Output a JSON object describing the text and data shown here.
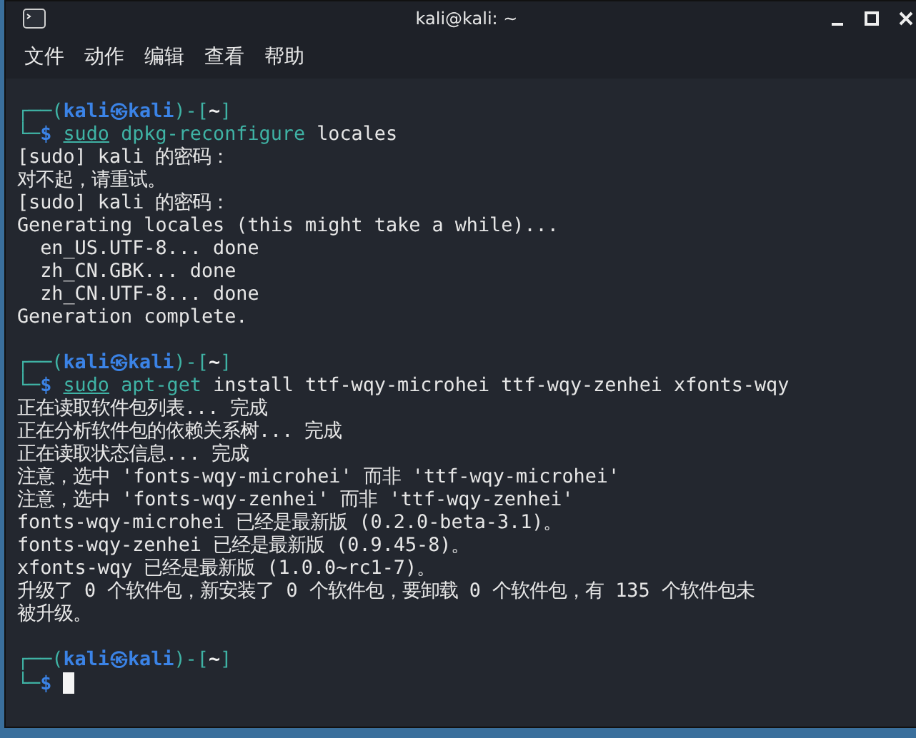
{
  "window": {
    "title": "kali@kali: ~"
  },
  "menu": [
    "文件",
    "动作",
    "编辑",
    "查看",
    "帮助"
  ],
  "terminal": [
    {
      "kind": "prompt",
      "open": "┌──(",
      "user": "kali",
      "at": "㉿",
      "host": "kali",
      "mid": ")-[",
      "dir": "~",
      "close": "]"
    },
    {
      "kind": "command",
      "corner": "└─",
      "sigil": "$",
      "sudo": "sudo",
      "program": "dpkg-reconfigure",
      "args": "locales"
    },
    {
      "kind": "output",
      "text": "[sudo] kali 的密码："
    },
    {
      "kind": "output",
      "text": "对不起，请重试。"
    },
    {
      "kind": "output",
      "text": "[sudo] kali 的密码："
    },
    {
      "kind": "output",
      "text": "Generating locales (this might take a while)..."
    },
    {
      "kind": "output",
      "text": "  en_US.UTF-8... done"
    },
    {
      "kind": "output",
      "text": "  zh_CN.GBK... done"
    },
    {
      "kind": "output",
      "text": "  zh_CN.UTF-8... done"
    },
    {
      "kind": "output",
      "text": "Generation complete."
    },
    {
      "kind": "blank"
    },
    {
      "kind": "prompt",
      "open": "┌──(",
      "user": "kali",
      "at": "㉿",
      "host": "kali",
      "mid": ")-[",
      "dir": "~",
      "close": "]"
    },
    {
      "kind": "command",
      "corner": "└─",
      "sigil": "$",
      "sudo": "sudo",
      "program": "apt-get",
      "args": "install ttf-wqy-microhei ttf-wqy-zenhei xfonts-wqy"
    },
    {
      "kind": "output",
      "text": "正在读取软件包列表... 完成"
    },
    {
      "kind": "output",
      "text": "正在分析软件包的依赖关系树... 完成"
    },
    {
      "kind": "output",
      "text": "正在读取状态信息... 完成"
    },
    {
      "kind": "output",
      "text": "注意，选中 'fonts-wqy-microhei' 而非 'ttf-wqy-microhei'"
    },
    {
      "kind": "output",
      "text": "注意，选中 'fonts-wqy-zenhei' 而非 'ttf-wqy-zenhei'"
    },
    {
      "kind": "output",
      "text": "fonts-wqy-microhei 已经是最新版 (0.2.0-beta-3.1)。"
    },
    {
      "kind": "output",
      "text": "fonts-wqy-zenhei 已经是最新版 (0.9.45-8)。"
    },
    {
      "kind": "output",
      "text": "xfonts-wqy 已经是最新版 (1.0.0~rc1-7)。"
    },
    {
      "kind": "output",
      "text": "升级了 0 个软件包，新安装了 0 个软件包，要卸载 0 个软件包，有 135 个软件包未"
    },
    {
      "kind": "output",
      "text": "被升级。"
    },
    {
      "kind": "blank"
    },
    {
      "kind": "prompt",
      "open": "┌──(",
      "user": "kali",
      "at": "㉿",
      "host": "kali",
      "mid": ")-[",
      "dir": "~",
      "close": "]"
    },
    {
      "kind": "input",
      "corner": "└─",
      "sigil": "$",
      "cursor": true
    }
  ]
}
